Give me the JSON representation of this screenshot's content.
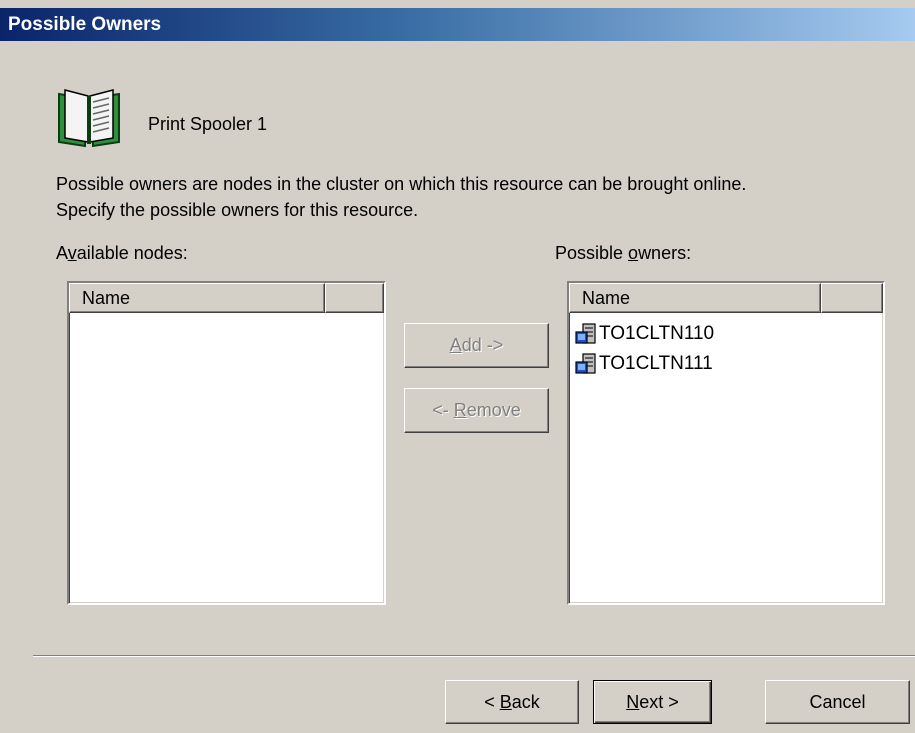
{
  "window": {
    "title": "Possible Owners"
  },
  "resource": {
    "name": "Print Spooler 1",
    "icon": "book-icon"
  },
  "description": {
    "line1": "Possible owners are nodes in the cluster on which this resource can be brought online.",
    "line2": "Specify the possible owners for this resource."
  },
  "available": {
    "label_pre": "A",
    "label_accel": "v",
    "label_post": "ailable nodes:",
    "columns": [
      "Name",
      ""
    ],
    "items": []
  },
  "owners": {
    "label_pre": "Possible ",
    "label_accel": "o",
    "label_post": "wners:",
    "columns": [
      "Name",
      ""
    ],
    "items": [
      {
        "name": "TO1CLTN110",
        "icon": "cluster-node-icon"
      },
      {
        "name": "TO1CLTN111",
        "icon": "cluster-node-icon"
      }
    ]
  },
  "buttons": {
    "add": {
      "accel": "A",
      "rest": "dd ->"
    },
    "remove": {
      "pre": "<- ",
      "accel": "R",
      "rest": "emove"
    },
    "back": {
      "pre": "< ",
      "accel": "B",
      "rest": "ack"
    },
    "next": {
      "accel": "N",
      "rest": "ext >"
    },
    "cancel": "Cancel"
  }
}
